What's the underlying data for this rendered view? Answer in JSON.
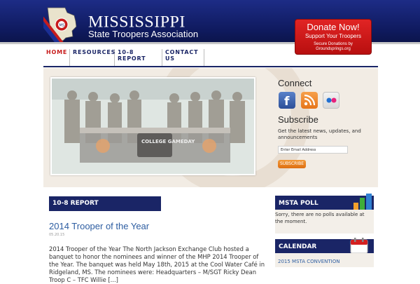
{
  "header": {
    "title": "MISSISSIPPI",
    "subtitle": "State Troopers Association",
    "donate": {
      "line1": "Donate Now!",
      "line2": "Support Your Troopers",
      "line3": "Secure Donations by",
      "line4": "Groundsprings.org"
    }
  },
  "nav": {
    "items": [
      {
        "label": "HOME"
      },
      {
        "label": "RESOURCES"
      },
      {
        "label": "10-8 REPORT"
      },
      {
        "label": "CONTACT US"
      }
    ]
  },
  "hero": {
    "photo_banner": "COLLEGE GAMEDAY"
  },
  "connect": {
    "heading": "Connect",
    "icons": [
      "facebook-icon",
      "rss-icon",
      "flickr-icon"
    ]
  },
  "subscribe": {
    "heading": "Subscribe",
    "text": "Get the latest news, updates, and announcements",
    "placeholder": "Enter Email Address",
    "button": "SUBSCRIBE"
  },
  "report": {
    "heading": "10-8 REPORT",
    "post": {
      "title": "2014 Trooper of the Year",
      "date": "05.20.15",
      "body": "2014 Trooper of the Year The North Jackson Exchange Club hosted a banquet to honor the nominees and winner of the MHP 2014 Trooper of the Year.  The banquet was held May 18th, 2015 at the Cool Water Café in Ridgeland, MS. The nominees were: Headquarters – M/SGT Ricky Dean Troop C – TFC Willie [...]"
    }
  },
  "poll": {
    "heading": "MSTA POLL",
    "text": "Sorry, there are no polls available at the moment."
  },
  "calendar": {
    "heading": "CALENDAR",
    "link": "2015 MSTA CONVENTION"
  },
  "colors": {
    "navy": "#1a2566",
    "accent_red": "#c71c1c",
    "link_blue": "#2d5da1",
    "donate_red": "#d41b1b",
    "subscribe_orange": "#ec8a2a"
  }
}
